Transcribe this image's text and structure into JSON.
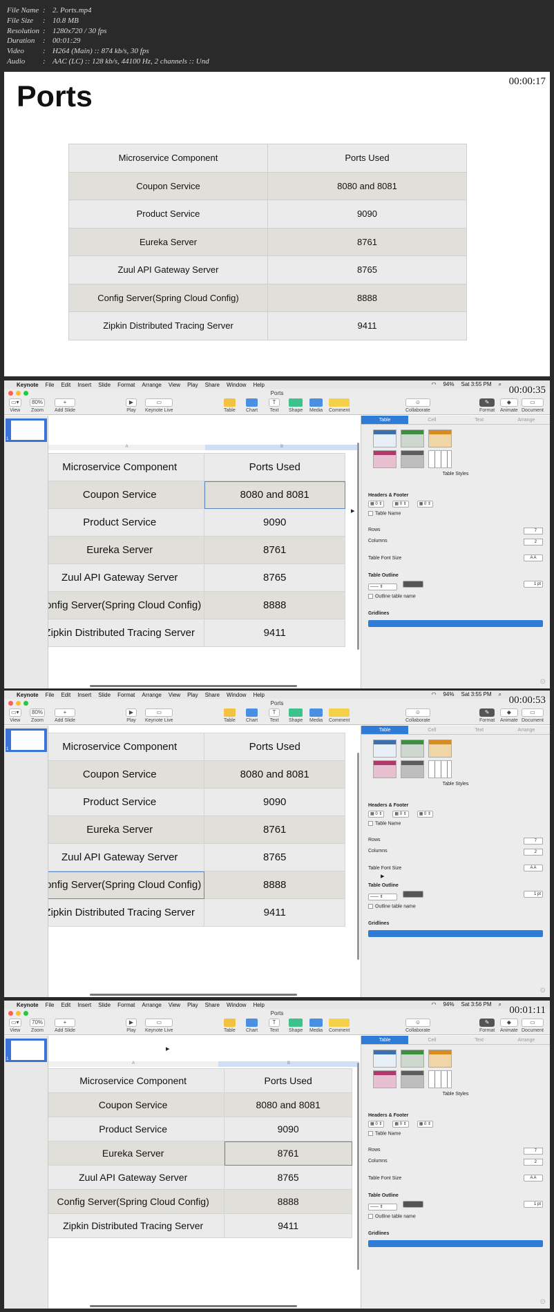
{
  "file_info": [
    {
      "key": "File Name",
      "value": "2. Ports.mp4"
    },
    {
      "key": "File Size",
      "value": "10.8 MB"
    },
    {
      "key": "Resolution",
      "value": "1280x720 / 30 fps"
    },
    {
      "key": "Duration",
      "value": "00:01:29"
    },
    {
      "key": "Video",
      "value": "H264 (Main) :: 874 kb/s, 30 fps"
    },
    {
      "key": "Audio",
      "value": "AAC (LC) :: 128 kb/s, 44100 Hz, 2 channels :: Und"
    }
  ],
  "frames": [
    {
      "timestamp": "00:00:17"
    },
    {
      "timestamp": "00:00:35"
    },
    {
      "timestamp": "00:00:53"
    },
    {
      "timestamp": "00:01:11"
    }
  ],
  "slide": {
    "title": "Ports",
    "headers": [
      "Microservice Component",
      "Ports Used"
    ],
    "rows": [
      [
        "Coupon Service",
        "8080 and 8081"
      ],
      [
        "Product Service",
        "9090"
      ],
      [
        "Eureka Server",
        "8761"
      ],
      [
        "Zuul API Gateway Server",
        "8765"
      ],
      [
        "Config Server(Spring Cloud Config)",
        "8888"
      ],
      [
        "Zipkin Distributed Tracing Server",
        "9411"
      ]
    ]
  },
  "keynote": {
    "menu": [
      "Keynote",
      "File",
      "Edit",
      "Insert",
      "Slide",
      "Format",
      "Arrange",
      "View",
      "Play",
      "Share",
      "Window",
      "Help"
    ],
    "status": [
      "94%"
    ],
    "times": [
      "Sat 3:55 PM",
      "Sat 3:55 PM",
      "Sat 3:56 PM"
    ],
    "window_title": "Ports",
    "zooms": [
      "80%",
      "80%",
      "70%"
    ],
    "toolbar_left": [
      "View",
      "Zoom",
      "Add Slide"
    ],
    "toolbar_mid": [
      "Play",
      "Keynote Live"
    ],
    "toolbar_insert": [
      "Table",
      "Chart",
      "Text",
      "Shape",
      "Media",
      "Comment"
    ],
    "toolbar_right": [
      "Collaborate"
    ],
    "toolbar_panels": [
      "Format",
      "Animate",
      "Document"
    ],
    "col_labels": [
      "A",
      "B"
    ],
    "inspector": {
      "tabs": [
        "Table",
        "Cell",
        "Text",
        "Arrange"
      ],
      "table_styles": "Table Styles",
      "headers_footer": "Headers & Footer",
      "hf_values": [
        "0",
        "0",
        "0"
      ],
      "table_name": "Table Name",
      "rows_label": "Rows",
      "rows_value": "7",
      "cols_label": "Columns",
      "cols_value": "2",
      "font_size": "Table Font Size",
      "outline": "Table Outline",
      "outline_value": "1 pt",
      "outline_name": "Outline table name",
      "gridlines": "Gridlines"
    }
  },
  "colors": {
    "selection": "#2e7bd8",
    "row_a": "#ebebeb",
    "row_b": "#e1dfda"
  }
}
